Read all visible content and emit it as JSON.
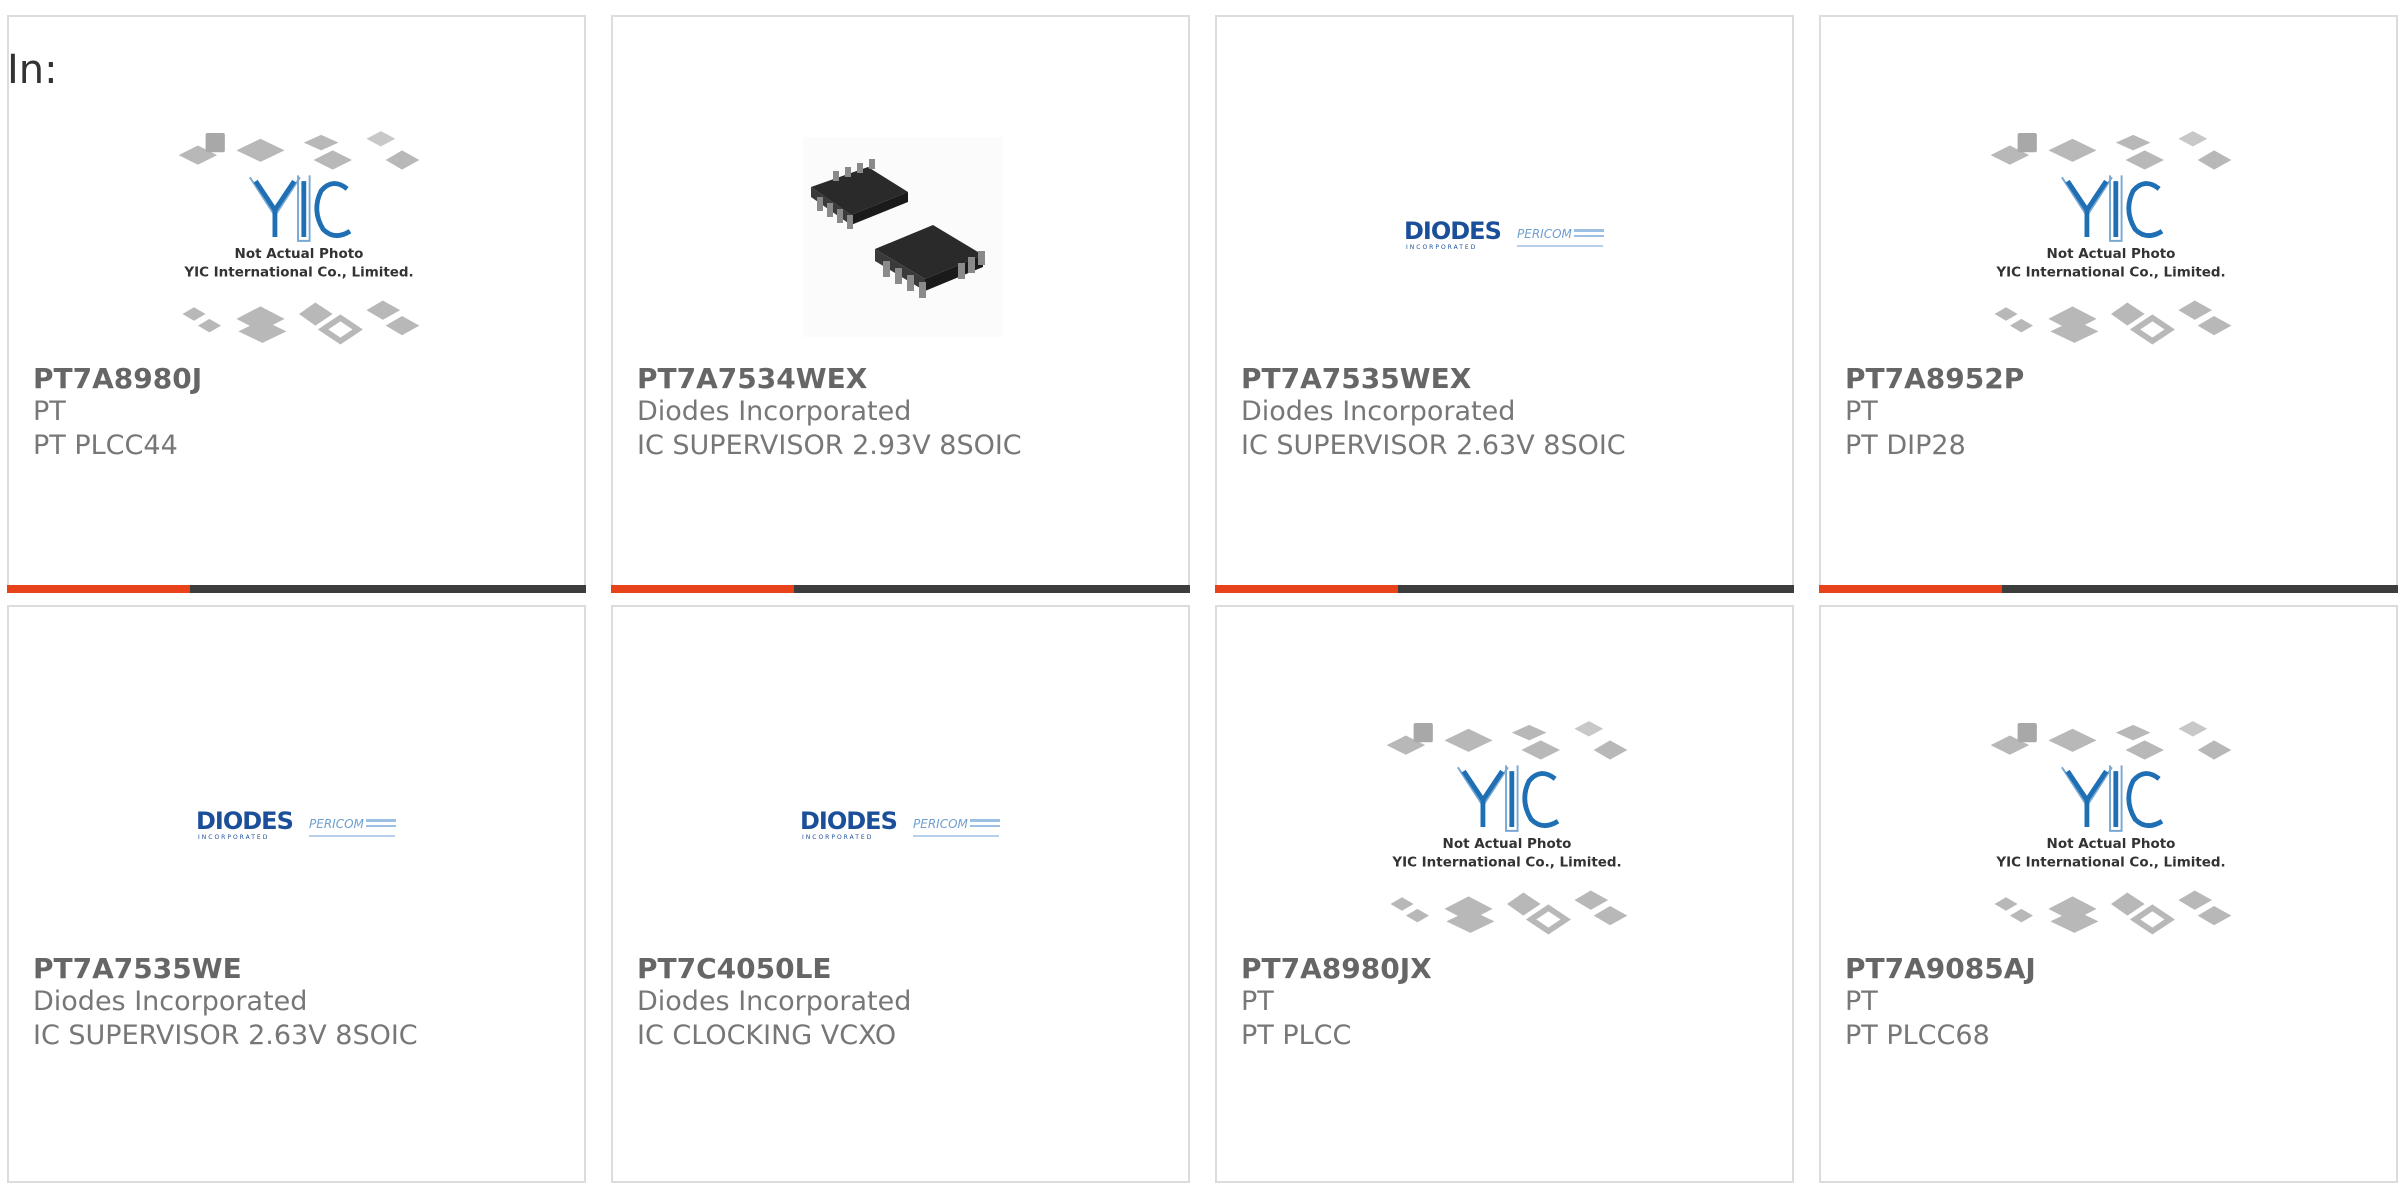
{
  "heading": "In:",
  "colors": {
    "accent": "#e8421b",
    "bar": "#3d3d3d",
    "border": "#dcdcdc",
    "yic_blue": "#1f6fb5",
    "diodes_blue": "#1b4f9a"
  },
  "products": [
    {
      "part": "PT7A8980J",
      "maker": "PT",
      "desc": "PT PLCC44",
      "image": "yic-placeholder"
    },
    {
      "part": "PT7A7534WEX",
      "maker": "Diodes Incorporated",
      "desc": "IC SUPERVISOR 2.93V 8SOIC",
      "image": "soic8-chip"
    },
    {
      "part": "PT7A7535WEX",
      "maker": "Diodes Incorporated",
      "desc": "IC SUPERVISOR 2.63V 8SOIC",
      "image": "diodes-logo"
    },
    {
      "part": "PT7A8952P",
      "maker": "PT",
      "desc": "PT DIP28",
      "image": "yic-placeholder"
    },
    {
      "part": "PT7A7535WE",
      "maker": "Diodes Incorporated",
      "desc": "IC SUPERVISOR 2.63V 8SOIC",
      "image": "diodes-logo"
    },
    {
      "part": "PT7C4050LE",
      "maker": "Diodes Incorporated",
      "desc": "IC CLOCKING VCXO",
      "image": "diodes-logo"
    },
    {
      "part": "PT7A8980JX",
      "maker": "PT",
      "desc": "PT PLCC",
      "image": "yic-placeholder"
    },
    {
      "part": "PT7A9085AJ",
      "maker": "PT",
      "desc": "PT PLCC68",
      "image": "yic-placeholder"
    }
  ],
  "yic": {
    "line1": "Not Actual Photo",
    "line2": "YIC International Co., Limited."
  },
  "diodes": {
    "brand": "DIODES",
    "tagline": "INCORPORATED",
    "sub": "PERICOM"
  }
}
